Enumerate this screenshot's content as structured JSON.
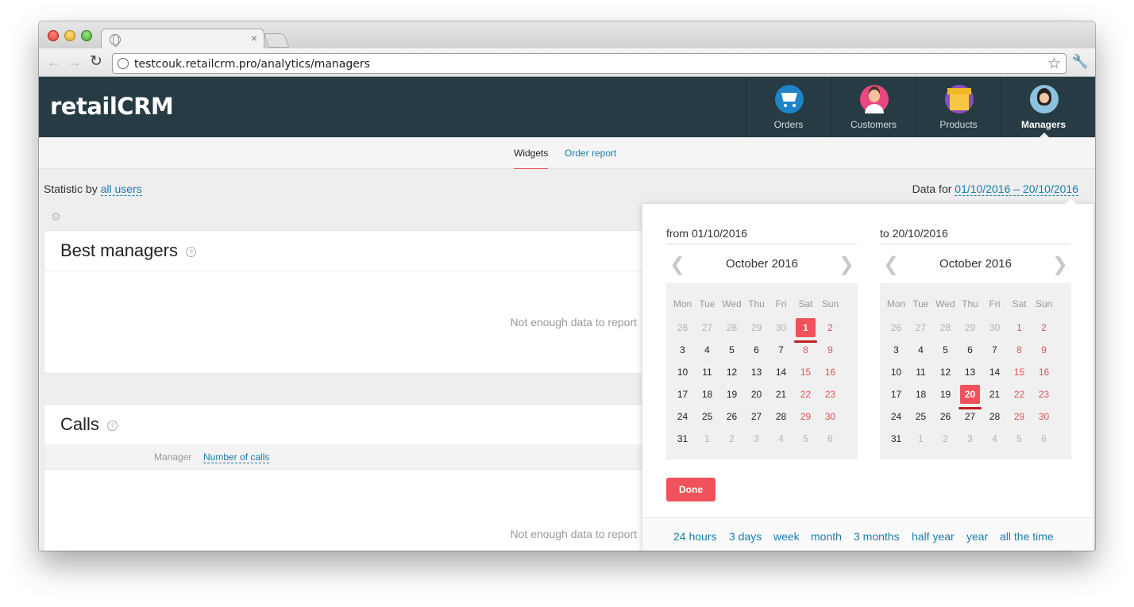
{
  "browser": {
    "url": "testcouk.retailcrm.pro/analytics/managers"
  },
  "app": {
    "logo": "retailCRM",
    "nav": [
      {
        "label": "Orders",
        "icon": "cart-icon"
      },
      {
        "label": "Customers",
        "icon": "customer-avatar-icon"
      },
      {
        "label": "Products",
        "icon": "box-icon"
      },
      {
        "label": "Managers",
        "icon": "manager-avatar-icon",
        "active": true
      }
    ]
  },
  "subnav": {
    "widgets": "Widgets",
    "order_report": "Order report"
  },
  "stats": {
    "prefix": "Statistic by",
    "users_link": "all users",
    "data_for": "Data for",
    "range_link": "01/10/2016 – 20/10/2016"
  },
  "panels": {
    "best_managers": {
      "title": "Best managers",
      "help": "?",
      "empty": "Not enough data to report"
    },
    "calls": {
      "title": "Calls",
      "help": "?",
      "col_manager": "Manager",
      "col_calls": "Number of calls",
      "empty": "Not enough data to report"
    }
  },
  "picker": {
    "from_label": "from",
    "from_value": "01/10/2016",
    "to_label": "to",
    "to_value": "20/10/2016",
    "month_left": "October 2016",
    "month_right": "October 2016",
    "weekdays": [
      "Mon",
      "Tue",
      "Wed",
      "Thu",
      "Fri",
      "Sat",
      "Sun"
    ],
    "weeks": [
      [
        "26",
        "27",
        "28",
        "29",
        "30",
        "1",
        "2"
      ],
      [
        "3",
        "4",
        "5",
        "6",
        "7",
        "8",
        "9"
      ],
      [
        "10",
        "11",
        "12",
        "13",
        "14",
        "15",
        "16"
      ],
      [
        "17",
        "18",
        "19",
        "20",
        "21",
        "22",
        "23"
      ],
      [
        "24",
        "25",
        "26",
        "27",
        "28",
        "29",
        "30"
      ],
      [
        "31",
        "1",
        "2",
        "3",
        "4",
        "5",
        "6"
      ]
    ],
    "selected_left": "1",
    "selected_right": "20",
    "done": "Done",
    "presets": [
      "24 hours",
      "3 days",
      "week",
      "month",
      "3 months",
      "half year",
      "year",
      "all the time"
    ],
    "colors": {
      "accent": "#f0525b",
      "link": "#1a7dad",
      "weekend": "#e0525a"
    }
  }
}
